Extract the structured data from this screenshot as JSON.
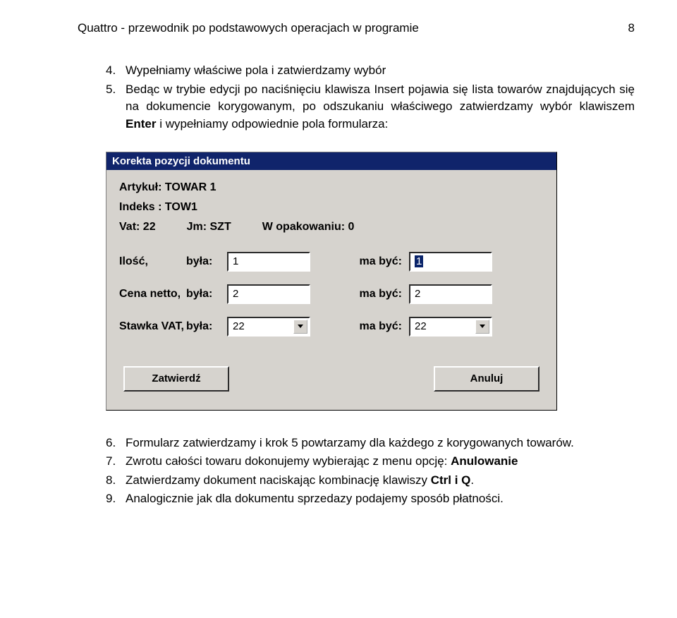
{
  "header": {
    "title": "Quattro - przewodnik po podstawowych operacjach w programie",
    "page_number": "8"
  },
  "intro": {
    "items": [
      {
        "num": "4.",
        "text": "Wypełniamy właściwe pola i zatwierdzamy wybór"
      },
      {
        "num": "5.",
        "text_parts": [
          "Bedąc w trybie edycji po naciśnięciu klawisza Insert pojawia się lista towarów znajdujących się na dokumencie korygowanym, po odszukaniu właściwego zatwierdzamy wybór klawiszem ",
          "Enter",
          " i wypełniamy odpowiednie pola formularza:"
        ]
      }
    ]
  },
  "dialog": {
    "title": "Korekta pozycji dokumentu",
    "artykul_label": "Artykuł:",
    "artykul_value": "TOWAR 1",
    "indeks_label": "Indeks :",
    "indeks_value": "TOW1",
    "vat_label": "Vat:",
    "vat_value": "22",
    "jm_label": "Jm:",
    "jm_value": "SZT",
    "wopak_label": "W opakowaniu:",
    "wopak_value": "0",
    "byla_label": "była:",
    "mabyc_label": "ma być:",
    "rows": {
      "ilosc": {
        "label": "Ilość,",
        "byla": "1",
        "mabyc": "1"
      },
      "cena": {
        "label": "Cena netto,",
        "byla": "2",
        "mabyc": "2"
      },
      "stawka": {
        "label": "Stawka VAT,",
        "byla": "22",
        "mabyc": "22"
      }
    },
    "buttons": {
      "ok": "Zatwierdź",
      "cancel": "Anuluj"
    }
  },
  "after": {
    "items": [
      {
        "num": "6.",
        "text": "Formularz zatwierdzamy i krok 5 powtarzamy dla każdego z korygowanych towarów."
      },
      {
        "num": "7.",
        "text_parts": [
          "Zwrotu całości towaru dokonujemy wybierając z menu opcję: ",
          "Anulowanie"
        ]
      },
      {
        "num": "8.",
        "text_parts": [
          "Zatwierdzamy dokument naciskając kombinację klawiszy ",
          "Ctrl i Q",
          "."
        ]
      },
      {
        "num": "9.",
        "text": "Analogicznie jak dla dokumentu sprzedazy podajemy sposób płatności."
      }
    ]
  }
}
